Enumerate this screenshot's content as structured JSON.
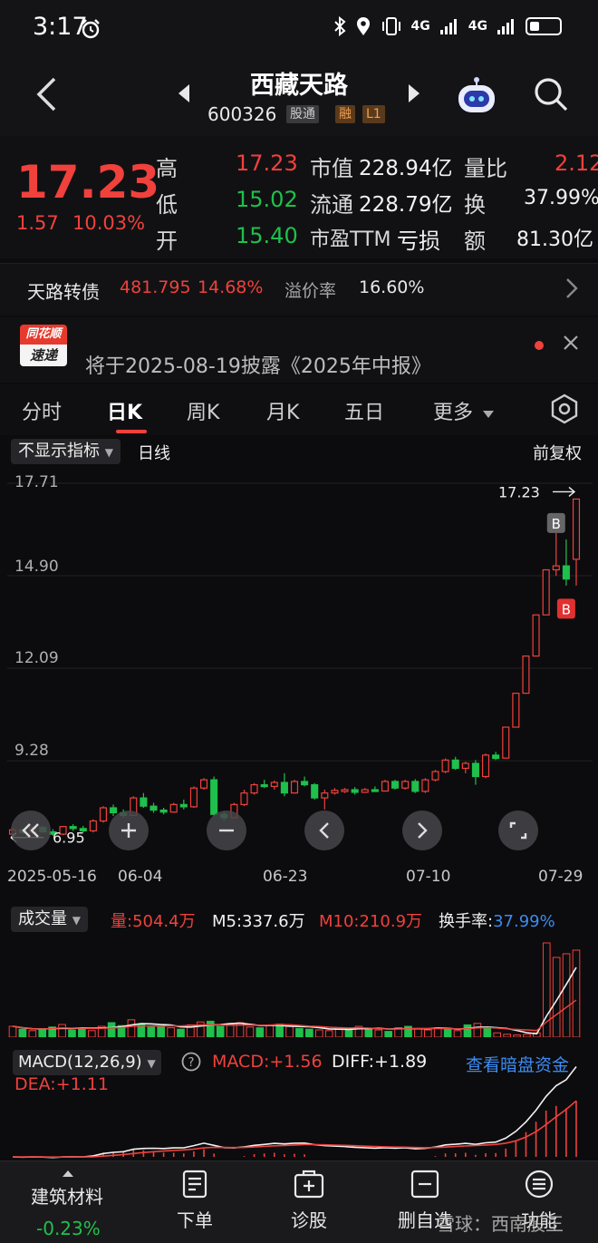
{
  "status_bar": {
    "time": "3:17",
    "signal_1": "4G",
    "signal_2": "4G"
  },
  "header": {
    "stock_name": "西藏天路",
    "stock_code": "600326",
    "tag_tong": "股通",
    "tag_rong": "融",
    "tag_level": "L1"
  },
  "quote": {
    "price": "17.23",
    "change": "1.57",
    "change_pct": "10.03%",
    "high_label": "高",
    "high": "17.23",
    "low_label": "低",
    "low": "15.02",
    "open_label": "开",
    "open": "15.40",
    "mktcap_label": "市值",
    "mktcap": "228.94亿",
    "float_label": "流通",
    "float": "228.79亿",
    "pe_label": "市盈TTM",
    "pe": "亏损",
    "volratio_label": "量比",
    "volratio": "2.12",
    "turnover_label": "换",
    "turnover": "37.99%",
    "amount_label": "额",
    "amount": "81.30亿"
  },
  "bond": {
    "name": "天路转债",
    "price": "481.795",
    "pct": "14.68%",
    "premium_label": "溢价率",
    "premium": "16.60%"
  },
  "news": {
    "logo_top": "同花顺",
    "logo_bottom": "速递",
    "text": "将于2025-08-19披露《2025年中报》"
  },
  "tabs": [
    "分时",
    "日K",
    "周K",
    "月K",
    "五日",
    "更多"
  ],
  "chart_toolbar": {
    "indicator": "不显示指标",
    "line_type": "日线",
    "adj_mode": "前复权"
  },
  "chart_data": {
    "type": "candlestick",
    "y_ticks": [
      "17.71",
      "14.90",
      "12.09",
      "9.28"
    ],
    "x_ticks": [
      "2025-05-16",
      "06-04",
      "06-23",
      "07-10",
      "07-29"
    ],
    "ylim": [
      6.5,
      17.71
    ],
    "max_label": "17.23",
    "min_label": "6.95",
    "marker_b": "B",
    "candles": [
      [
        7.05,
        7.25,
        7.0,
        7.18
      ],
      [
        7.18,
        7.22,
        7.05,
        7.1
      ],
      [
        7.1,
        7.28,
        7.05,
        7.25
      ],
      [
        7.25,
        7.3,
        7.1,
        7.12
      ],
      [
        7.12,
        7.2,
        7.0,
        7.05
      ],
      [
        7.05,
        7.3,
        7.02,
        7.28
      ],
      [
        7.28,
        7.35,
        7.15,
        7.22
      ],
      [
        7.22,
        7.3,
        7.1,
        7.15
      ],
      [
        7.15,
        7.5,
        7.1,
        7.45
      ],
      [
        7.45,
        7.9,
        7.4,
        7.85
      ],
      [
        7.85,
        7.95,
        7.6,
        7.7
      ],
      [
        7.7,
        7.8,
        7.55,
        7.62
      ],
      [
        7.62,
        8.2,
        7.6,
        8.15
      ],
      [
        8.15,
        8.3,
        7.85,
        7.9
      ],
      [
        7.9,
        8.0,
        7.7,
        7.78
      ],
      [
        7.78,
        7.85,
        7.65,
        7.72
      ],
      [
        7.72,
        8.0,
        7.7,
        7.95
      ],
      [
        7.95,
        8.1,
        7.8,
        7.88
      ],
      [
        7.88,
        8.5,
        7.85,
        8.45
      ],
      [
        8.45,
        8.75,
        8.4,
        8.7
      ],
      [
        8.7,
        8.8,
        7.6,
        7.65
      ],
      [
        7.65,
        7.75,
        7.45,
        7.55
      ],
      [
        7.55,
        8.0,
        7.52,
        7.95
      ],
      [
        7.95,
        8.4,
        7.9,
        8.3
      ],
      [
        8.3,
        8.6,
        8.25,
        8.55
      ],
      [
        8.55,
        8.7,
        8.45,
        8.5
      ],
      [
        8.5,
        8.68,
        8.4,
        8.62
      ],
      [
        8.62,
        8.9,
        8.2,
        8.3
      ],
      [
        8.3,
        8.7,
        8.28,
        8.65
      ],
      [
        8.65,
        8.8,
        8.5,
        8.55
      ],
      [
        8.55,
        8.6,
        8.1,
        8.15
      ],
      [
        8.15,
        8.4,
        7.8,
        8.3
      ],
      [
        8.3,
        8.45,
        8.25,
        8.38
      ],
      [
        8.38,
        8.45,
        8.3,
        8.4
      ],
      [
        8.4,
        8.48,
        8.25,
        8.32
      ],
      [
        8.32,
        8.45,
        8.3,
        8.4
      ],
      [
        8.4,
        8.5,
        8.35,
        8.36
      ],
      [
        8.36,
        8.7,
        8.34,
        8.65
      ],
      [
        8.65,
        8.7,
        8.4,
        8.45
      ],
      [
        8.45,
        8.7,
        8.4,
        8.65
      ],
      [
        8.65,
        8.72,
        8.3,
        8.35
      ],
      [
        8.35,
        8.75,
        8.3,
        8.7
      ],
      [
        8.7,
        9.0,
        8.65,
        8.95
      ],
      [
        8.95,
        9.35,
        8.9,
        9.3
      ],
      [
        9.3,
        9.4,
        9.0,
        9.05
      ],
      [
        9.05,
        9.25,
        8.9,
        9.2
      ],
      [
        9.2,
        9.3,
        8.55,
        8.8
      ],
      [
        8.8,
        9.5,
        8.75,
        9.45
      ],
      [
        9.45,
        9.55,
        9.3,
        9.35
      ],
      [
        9.36,
        10.3,
        9.36,
        10.3
      ],
      [
        10.3,
        11.33,
        10.3,
        11.33
      ],
      [
        11.33,
        12.46,
        11.33,
        12.46
      ],
      [
        12.46,
        13.71,
        12.46,
        13.71
      ],
      [
        13.71,
        15.08,
        13.71,
        15.08
      ],
      [
        15.08,
        16.2,
        14.9,
        15.2
      ],
      [
        15.2,
        16.0,
        14.6,
        14.8
      ],
      [
        15.4,
        17.23,
        14.6,
        17.23
      ]
    ]
  },
  "volume": {
    "select": "成交量",
    "vol": "量:504.4万",
    "m5": "M5:337.6万",
    "m10": "M10:210.9万",
    "turnover": "换手率:37.99%",
    "bars": [
      30,
      22,
      18,
      20,
      28,
      35,
      20,
      24,
      18,
      30,
      40,
      32,
      48,
      36,
      28,
      30,
      26,
      22,
      34,
      42,
      44,
      30,
      36,
      40,
      28,
      26,
      32,
      36,
      30,
      24,
      22,
      20,
      18,
      26,
      22,
      30,
      24,
      20,
      16,
      26,
      30,
      24,
      20,
      26,
      22,
      18,
      34,
      38,
      28,
      12,
      8,
      6,
      8,
      12,
      260,
      220,
      230,
      240
    ],
    "bar_colors": [
      "r",
      "g",
      "r",
      "g",
      "g",
      "r",
      "g",
      "g",
      "r",
      "r",
      "g",
      "g",
      "r",
      "g",
      "g",
      "g",
      "r",
      "g",
      "r",
      "r",
      "g",
      "g",
      "r",
      "r",
      "r",
      "g",
      "r",
      "g",
      "r",
      "g",
      "g",
      "r",
      "r",
      "r",
      "g",
      "r",
      "g",
      "r",
      "g",
      "r",
      "g",
      "r",
      "r",
      "r",
      "g",
      "r",
      "g",
      "r",
      "g",
      "r",
      "r",
      "r",
      "r",
      "r",
      "r",
      "r",
      "r",
      "r"
    ]
  },
  "macd": {
    "select": "MACD(12,26,9)",
    "macd": "MACD:+1.56",
    "diff": "DIFF:+1.89",
    "dea": "DEA:+1.11",
    "dark_pool": "查看暗盘资金"
  },
  "bottom_nav": {
    "sector_name": "建筑材料",
    "sector_pct": "-0.23%",
    "order": "下单",
    "diagnose": "诊股",
    "remove_watch": "删自选",
    "functions": "功能"
  },
  "watermark": "雪球：西南股王",
  "colors": {
    "up": "#f0413c",
    "down": "#1fc04c",
    "bg": "#0c0c0e"
  }
}
